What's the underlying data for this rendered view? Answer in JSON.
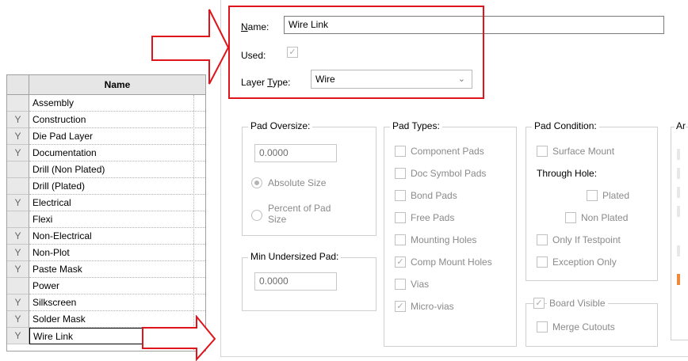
{
  "layer_table": {
    "header": {
      "flag": "",
      "name": "Name"
    },
    "rows": [
      {
        "flag": "",
        "name": "Assembly"
      },
      {
        "flag": "Y",
        "name": "Construction"
      },
      {
        "flag": "Y",
        "name": "Die Pad Layer"
      },
      {
        "flag": "Y",
        "name": "Documentation"
      },
      {
        "flag": "",
        "name": "Drill (Non Plated)"
      },
      {
        "flag": "",
        "name": "Drill (Plated)"
      },
      {
        "flag": "Y",
        "name": "Electrical"
      },
      {
        "flag": "",
        "name": "Flexi"
      },
      {
        "flag": "Y",
        "name": "Non-Electrical"
      },
      {
        "flag": "Y",
        "name": "Non-Plot"
      },
      {
        "flag": "Y",
        "name": "Paste Mask"
      },
      {
        "flag": "",
        "name": "Power"
      },
      {
        "flag": "Y",
        "name": "Silkscreen"
      },
      {
        "flag": "Y",
        "name": "Solder Mask"
      },
      {
        "flag": "Y",
        "name": "Wire Link"
      }
    ]
  },
  "form": {
    "name_label": "Name:",
    "name_value": "Wire Link",
    "used_label": "Used:",
    "used_checked": true,
    "layer_type_label": "Layer Type:",
    "layer_type_value": "Wire"
  },
  "pad_oversize": {
    "title": "Pad Oversize:",
    "value": "0.0000",
    "absolute_size": "Absolute Size",
    "percent_line1": "Percent of Pad",
    "percent_line2": "Size"
  },
  "min_undersized": {
    "title": "Min Undersized Pad:",
    "value": "0.0000"
  },
  "pad_types": {
    "title": "Pad Types:",
    "items": [
      {
        "label": "Component Pads",
        "checked": false
      },
      {
        "label": "Doc Symbol Pads",
        "checked": false
      },
      {
        "label": "Bond Pads",
        "checked": false
      },
      {
        "label": "Free Pads",
        "checked": false
      },
      {
        "label": "Mounting Holes",
        "checked": false
      },
      {
        "label": "Comp Mount Holes",
        "checked": true
      },
      {
        "label": "Vias",
        "checked": false
      },
      {
        "label": "Micro-vias",
        "checked": true
      }
    ]
  },
  "pad_condition": {
    "title": "Pad Condition:",
    "surface_mount": "Surface Mount",
    "through_hole": "Through Hole:",
    "plated": "Plated",
    "non_plated": "Non Plated",
    "only_if_testpoint": "Only If Testpoint",
    "exception_only": "Exception Only"
  },
  "board_visible": {
    "title": "Board Visible",
    "checked": true,
    "merge_cutouts": "Merge Cutouts"
  },
  "truncated_group": {
    "title": "Ar"
  },
  "colors": {
    "annotation_red": "#e0141b",
    "check_grey": "#aaaaaa"
  }
}
